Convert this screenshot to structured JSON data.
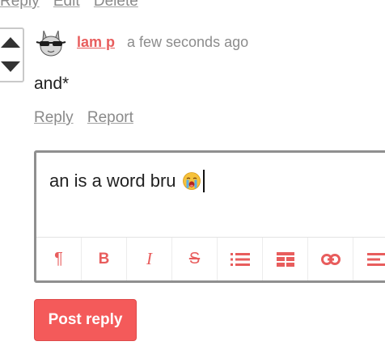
{
  "top_actions": {
    "reply": "Reply",
    "edit": "Edit",
    "delete": "Delete"
  },
  "comment": {
    "author": "lam p",
    "timestamp": "a few seconds ago",
    "body": "and*",
    "actions": {
      "reply": "Reply",
      "report": "Report"
    }
  },
  "editor": {
    "text": "an is a word bru",
    "emoji": "loudly-crying-face-emoji",
    "toolbar": [
      {
        "name": "paragraph",
        "icon": "pilcrow-icon",
        "glyph": "¶"
      },
      {
        "name": "bold",
        "icon": "bold-icon",
        "glyph": "B"
      },
      {
        "name": "italic",
        "icon": "italic-icon",
        "glyph": "I"
      },
      {
        "name": "strikethrough",
        "icon": "strikethrough-icon",
        "glyph": "S"
      },
      {
        "name": "bullet-list",
        "icon": "bullet-list-icon"
      },
      {
        "name": "table",
        "icon": "table-icon"
      },
      {
        "name": "link",
        "icon": "link-icon"
      },
      {
        "name": "align",
        "icon": "align-left-icon"
      }
    ]
  },
  "post_button": "Post reply",
  "colors": {
    "accent": "#e85d5d",
    "button": "#f45a5a",
    "muted_text": "#8a8a8a"
  }
}
